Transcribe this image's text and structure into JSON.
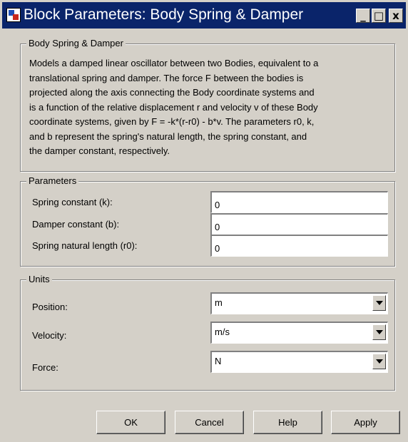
{
  "window": {
    "title": "Block Parameters: Body Spring & Damper",
    "controls": {
      "minimize": "_",
      "maximize": "□",
      "close": "x"
    }
  },
  "description_group": {
    "title": "Body Spring & Damper",
    "lines": [
      "Models a damped linear oscillator between two Bodies, equivalent to a",
      "translational spring and damper. The force F between the bodies is",
      "projected along the axis connecting the Body coordinate systems and",
      "is a function of the relative displacement r and velocity v of these Body",
      "coordinate systems, given by F = -k*(r-r0) - b*v. The parameters r0, k,",
      "and b represent the spring's natural length, the spring constant, and",
      "the damper constant, respectively."
    ]
  },
  "parameters": {
    "title": "Parameters",
    "fields": [
      {
        "label": "Spring constant (k):",
        "value": "0"
      },
      {
        "label": "Damper constant (b):",
        "value": "0"
      },
      {
        "label": "Spring natural length (r0):",
        "value": "0"
      }
    ]
  },
  "units": {
    "title": "Units",
    "fields": [
      {
        "label": "Position:",
        "value": "m"
      },
      {
        "label": "Velocity:",
        "value": "m/s"
      },
      {
        "label": "Force:",
        "value": "N"
      }
    ]
  },
  "buttons": {
    "ok": "OK",
    "cancel": "Cancel",
    "help": "Help",
    "apply": "Apply"
  },
  "colors": {
    "titlebar": "#0a246a",
    "dialog_bg": "#d4d0c8",
    "field_bg": "#ffffff"
  }
}
